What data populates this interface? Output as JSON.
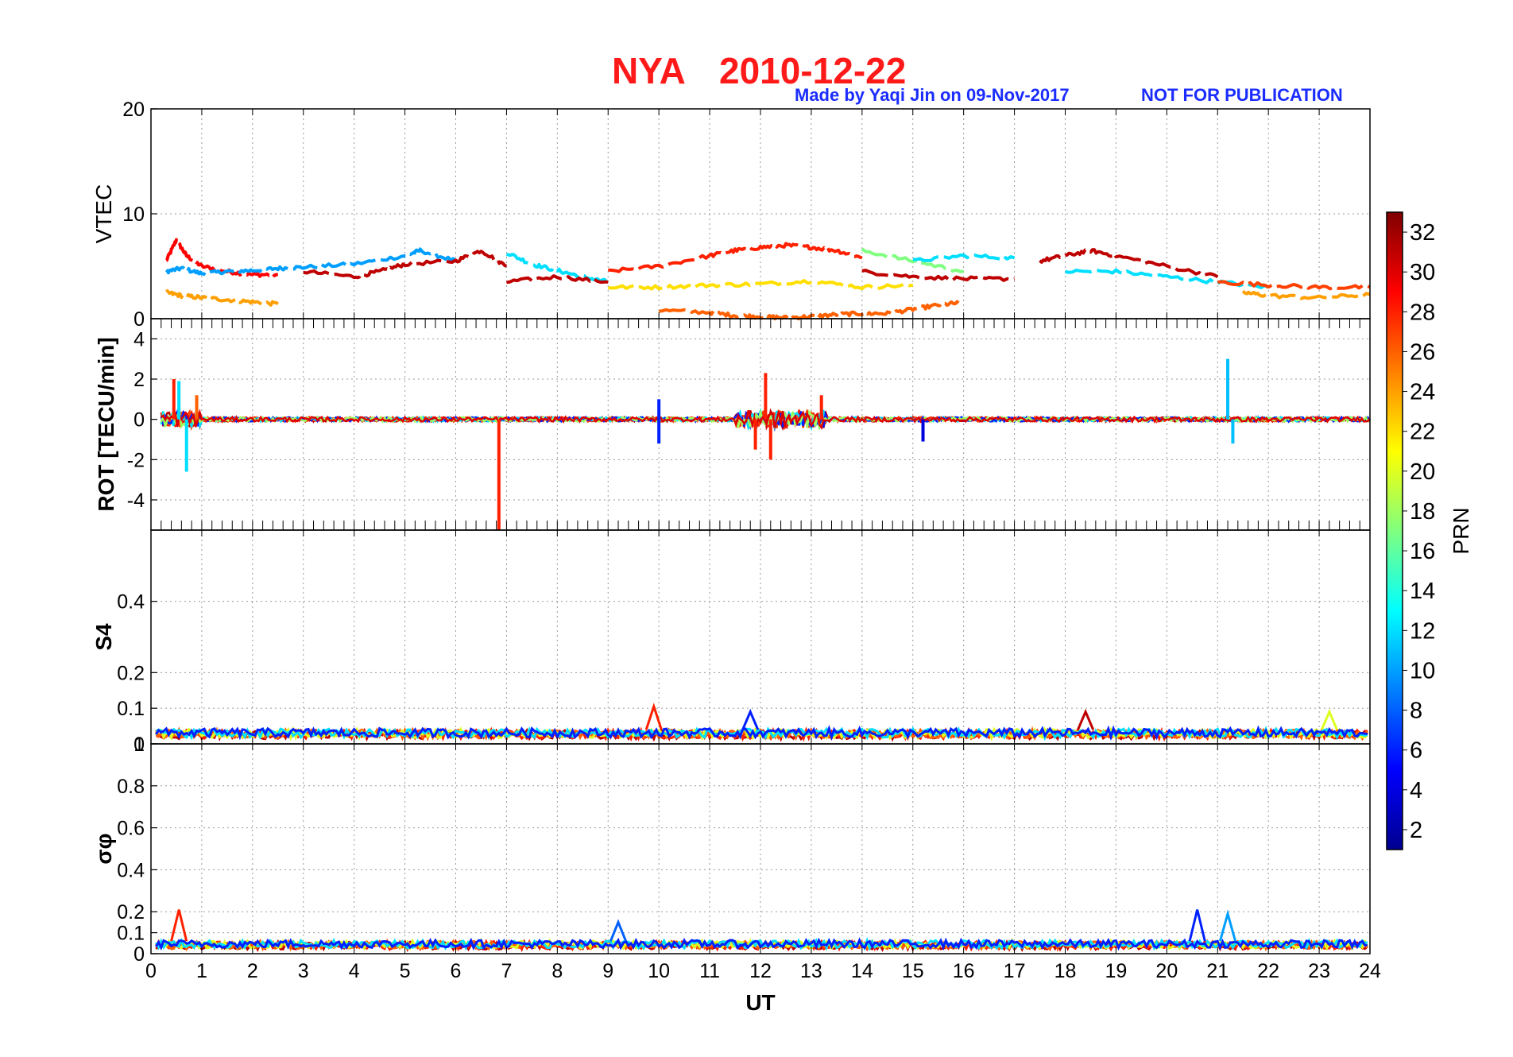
{
  "title": {
    "station": "NYA",
    "date": "2010-12-22"
  },
  "credit": {
    "made_by": "Made by Yaqi Jin on 09-Nov-2017",
    "notice": "NOT FOR PUBLICATION"
  },
  "colorbar": {
    "label": "PRN",
    "ticks": [
      "2",
      "4",
      "6",
      "8",
      "10",
      "12",
      "14",
      "16",
      "18",
      "20",
      "22",
      "24",
      "26",
      "28",
      "30",
      "32"
    ],
    "range": [
      1,
      33
    ],
    "colormap": "jet"
  },
  "chart_data": [
    {
      "type": "line",
      "panel": "VTEC",
      "ylabel": "VTEC",
      "ylim": [
        0,
        20
      ],
      "yticks": [
        "0",
        "10",
        "20"
      ],
      "xlim": [
        0,
        24
      ],
      "grid": true,
      "series": [
        {
          "prn": 29,
          "x": [
            0.3,
            0.5,
            0.7,
            1.0,
            1.5,
            2.0,
            2.5
          ],
          "y": [
            5.5,
            7.5,
            6.0,
            5.0,
            4.5,
            4.2,
            4.2
          ]
        },
        {
          "prn": 10,
          "x": [
            0.3,
            0.6,
            1.0,
            1.5,
            2.0,
            2.5,
            3.0,
            4.0,
            5.0,
            5.3,
            6.0
          ],
          "y": [
            4.5,
            4.8,
            4.3,
            4.5,
            4.6,
            4.8,
            4.9,
            5.2,
            6.0,
            6.5,
            5.5
          ]
        },
        {
          "prn": 24,
          "x": [
            0.3,
            0.6,
            1.0,
            1.5,
            2.0,
            2.5
          ],
          "y": [
            2.5,
            2.2,
            2.0,
            1.8,
            1.6,
            1.4
          ]
        },
        {
          "prn": 31,
          "x": [
            3.0,
            4.0,
            4.5,
            5.0,
            6.0,
            6.5,
            7.0
          ],
          "y": [
            4.5,
            4.0,
            4.5,
            5.2,
            5.5,
            6.5,
            5.0
          ]
        },
        {
          "prn": 12,
          "x": [
            7.0,
            7.5,
            8.0,
            8.5,
            9.0
          ],
          "y": [
            6.3,
            5.2,
            4.6,
            4.0,
            3.5
          ]
        },
        {
          "prn": 31,
          "x": [
            7.0,
            8.0,
            9.0
          ],
          "y": [
            3.5,
            4.0,
            3.5
          ]
        },
        {
          "prn": 26,
          "x": [
            10.0,
            11.0,
            11.5,
            12.0,
            12.5,
            13.0,
            13.5,
            14.0,
            14.5,
            15.0,
            15.5,
            15.9
          ],
          "y": [
            0.8,
            0.6,
            0.3,
            0.2,
            0.1,
            0.2,
            0.4,
            0.5,
            0.5,
            0.9,
            1.3,
            1.5
          ]
        },
        {
          "prn": 28,
          "x": [
            9.0,
            10.0,
            11.0,
            11.5,
            12.0,
            12.5,
            13.0,
            13.5,
            14.0
          ],
          "y": [
            4.5,
            5.0,
            6.0,
            6.5,
            6.8,
            7.0,
            6.8,
            6.5,
            5.8
          ]
        },
        {
          "prn": 22,
          "x": [
            9.0,
            10.0,
            11.0,
            12.0,
            13.0,
            14.0,
            15.0
          ],
          "y": [
            3.0,
            3.0,
            3.2,
            3.3,
            3.6,
            3.0,
            3.2
          ]
        },
        {
          "prn": 17,
          "x": [
            14.0,
            15.0,
            16.0
          ],
          "y": [
            6.5,
            5.5,
            4.5
          ]
        },
        {
          "prn": 12,
          "x": [
            15.0,
            16.0,
            17.0
          ],
          "y": [
            5.5,
            6.0,
            5.8
          ]
        },
        {
          "prn": 31,
          "x": [
            14.0,
            15.0,
            16.0,
            17.0
          ],
          "y": [
            4.5,
            4.0,
            3.8,
            3.8
          ]
        },
        {
          "prn": 31,
          "x": [
            17.5,
            18.0,
            18.5,
            19.0,
            20.0,
            21.0
          ],
          "y": [
            5.5,
            6.0,
            6.5,
            6.0,
            5.0,
            4.0
          ]
        },
        {
          "prn": 12,
          "x": [
            18.0,
            19.0,
            20.0,
            21.0,
            22.0
          ],
          "y": [
            4.5,
            4.5,
            4.0,
            3.5,
            3.0
          ]
        },
        {
          "prn": 27,
          "x": [
            21.0,
            22.0,
            23.0,
            24.0
          ],
          "y": [
            3.5,
            3.2,
            3.0,
            3.0
          ]
        },
        {
          "prn": 24,
          "x": [
            21.5,
            22.0,
            23.0,
            24.0
          ],
          "y": [
            2.5,
            2.2,
            2.0,
            2.3
          ]
        }
      ]
    },
    {
      "type": "line",
      "panel": "ROT",
      "ylabel": "ROT [TECU/min]",
      "ylim": [
        -5.5,
        5
      ],
      "yticks": [
        "-4",
        "-2",
        "0",
        "2",
        "4"
      ],
      "xlim": [
        0,
        24
      ],
      "grid": true,
      "baseline": 0,
      "spikes": [
        {
          "prn": 28,
          "x": 0.45,
          "y": 2.0
        },
        {
          "prn": 12,
          "x": 0.7,
          "y": -2.6
        },
        {
          "prn": 12,
          "x": 0.55,
          "y": 1.9
        },
        {
          "prn": 26,
          "x": 0.9,
          "y": 1.2
        },
        {
          "prn": 28,
          "x": 6.85,
          "y": -5.5
        },
        {
          "prn": 6,
          "x": 10.0,
          "y": 1.0
        },
        {
          "prn": 6,
          "x": 10.0,
          "y": -1.2
        },
        {
          "prn": 28,
          "x": 12.1,
          "y": 2.3
        },
        {
          "prn": 28,
          "x": 12.2,
          "y": -2.0
        },
        {
          "prn": 28,
          "x": 11.9,
          "y": -1.5
        },
        {
          "prn": 28,
          "x": 13.2,
          "y": 1.2
        },
        {
          "prn": 4,
          "x": 15.2,
          "y": -1.1
        },
        {
          "prn": 11,
          "x": 21.2,
          "y": 3.0
        },
        {
          "prn": 11,
          "x": 21.3,
          "y": -1.2
        }
      ]
    },
    {
      "type": "line",
      "panel": "S4",
      "ylabel": "S4",
      "ylim": [
        0,
        0.6
      ],
      "yticks": [
        "0",
        "0.1",
        "0.2",
        "0.4"
      ],
      "xlim": [
        0,
        24
      ],
      "grid": true,
      "typical_level": 0.04,
      "peaks": [
        {
          "prn": 28,
          "x": 9.9,
          "y": 0.105
        },
        {
          "prn": 31,
          "x": 18.4,
          "y": 0.09
        },
        {
          "prn": 6,
          "x": 11.8,
          "y": 0.09
        },
        {
          "prn": 20,
          "x": 23.2,
          "y": 0.09
        }
      ]
    },
    {
      "type": "line",
      "panel": "sigma_phi",
      "ylabel": "σφ",
      "ylim": [
        0,
        1
      ],
      "yticks": [
        "0",
        "0.1",
        "0.2",
        "0.4",
        "0.6",
        "0.8",
        "1"
      ],
      "xlim": [
        0,
        24
      ],
      "xticks": [
        "0",
        "1",
        "2",
        "3",
        "4",
        "5",
        "6",
        "7",
        "8",
        "9",
        "10",
        "11",
        "12",
        "13",
        "14",
        "15",
        "16",
        "17",
        "18",
        "19",
        "20",
        "21",
        "22",
        "23",
        "24"
      ],
      "xlabel": "UT",
      "grid": true,
      "typical_level": 0.06,
      "peaks": [
        {
          "prn": 28,
          "x": 0.55,
          "y": 0.21
        },
        {
          "prn": 6,
          "x": 20.6,
          "y": 0.21
        },
        {
          "prn": 10,
          "x": 21.2,
          "y": 0.19
        },
        {
          "prn": 8,
          "x": 9.2,
          "y": 0.15
        }
      ]
    }
  ]
}
